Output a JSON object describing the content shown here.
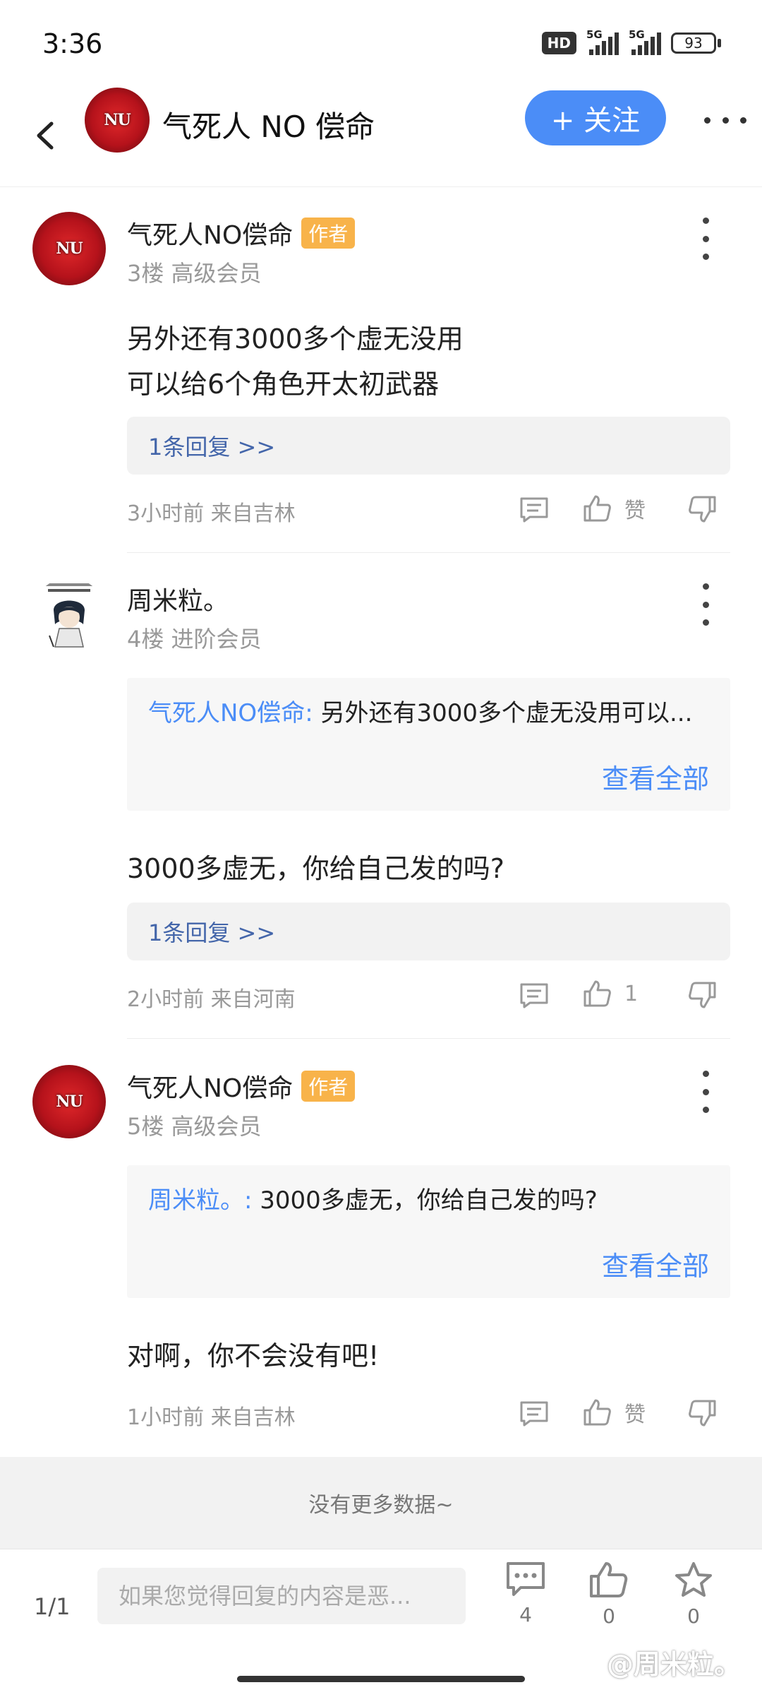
{
  "status_bar": {
    "time": "3:36",
    "hd_label": "HD",
    "signal_1_label": "5G",
    "signal_2_label": "5G",
    "battery": "93"
  },
  "header": {
    "title": "气死人 NO 偿命",
    "follow_label": "+ 关注",
    "avatar_mark": "NU"
  },
  "comments": [
    {
      "username": "气死人NO偿命",
      "badge": "作者",
      "meta": "3楼 高级会员",
      "content_lines": [
        "另外还有3000多个虚无没用",
        "可以给6个角色开太初武器"
      ],
      "reply_link": "1条回复 >>",
      "footer": "3小时前 来自吉林",
      "like_label": "赞"
    },
    {
      "username": "周米粒。",
      "meta": "4楼 进阶会员",
      "quote_name": "气死人NO偿命:",
      "quote_body": " 另外还有3000多个虚无没用可以...",
      "view_all": "查看全部",
      "content": "3000多虚无，你给自己发的吗?",
      "reply_link": "1条回复 >>",
      "footer": "2小时前 来自河南",
      "like_label": "1"
    },
    {
      "username": "气死人NO偿命",
      "badge": "作者",
      "meta": "5楼 高级会员",
      "quote_name": "周米粒。:",
      "quote_body": " 3000多虚无，你给自己发的吗?",
      "view_all": "查看全部",
      "content": "对啊，你不会没有吧!",
      "footer": "1小时前 来自吉林",
      "like_label": "赞"
    }
  ],
  "no_more_text": "没有更多数据~",
  "bottom_bar": {
    "page_indicator": "1/1",
    "input_placeholder": "如果您觉得回复的内容是恶...",
    "comment_count": "4",
    "like_count": "0",
    "star_count": "0"
  },
  "watermark": "@周米粒。",
  "colors": {
    "accent": "#4b8df7",
    "author_badge": "#f8b34a",
    "reply_link": "#4466aa"
  },
  "icons": [
    "back-arrow-icon",
    "more-dots-icon",
    "comment-icon",
    "thumbs-up-icon",
    "thumbs-down-icon",
    "star-icon"
  ]
}
